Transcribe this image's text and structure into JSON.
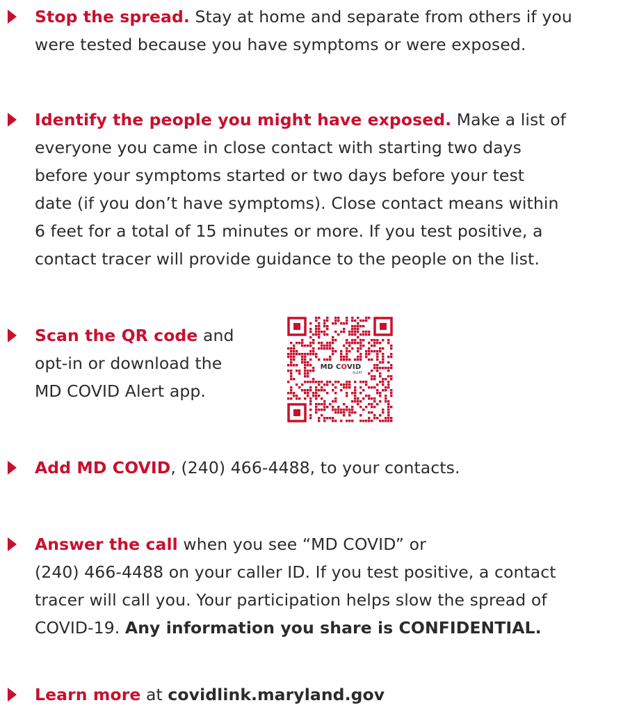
{
  "accent_color": "#c8102e",
  "text_color": "#2b2b2b",
  "items": [
    {
      "icon": "play-arrow-icon",
      "lines": [
        {
          "bold": "Stop the spread.",
          "rest": " Stay at home and separate from others if you"
        },
        {
          "rest": "were tested because you have symptoms or were exposed."
        }
      ]
    },
    {
      "icon": "play-arrow-icon",
      "lines": [
        {
          "bold": "Identify the people you might have exposed.",
          "rest": " Make a list of"
        },
        {
          "rest": "everyone you came in close contact with starting two days"
        },
        {
          "rest": "before your symptoms started or two days before your test"
        },
        {
          "rest": "date (if you don’t have symptoms). Close contact means within"
        },
        {
          "rest": "6 feet for a total of 15 minutes or more. If you test positive, a"
        },
        {
          "rest": "contact tracer will provide guidance to the people on the list."
        }
      ]
    },
    {
      "icon": "play-arrow-icon",
      "lines": [
        {
          "bold": "Scan the QR code",
          "rest": " and"
        },
        {
          "rest": "opt-in or download the"
        },
        {
          "rest": "MD COVID Alert app."
        }
      ]
    },
    {
      "icon": "play-arrow-icon",
      "lines": [
        {
          "bold": "Add MD COVID",
          "rest": ", (240) 466-4488, to your contacts."
        }
      ]
    },
    {
      "icon": "play-arrow-icon",
      "lines": [
        {
          "bold": "Answer the call",
          "rest": " when you see “MD COVID” or"
        },
        {
          "rest": "(240) 466-4488 on your caller ID. If you test positive, a contact"
        },
        {
          "rest": "tracer will call you. Your participation helps slow the spread of"
        },
        {
          "rest": "COVID-19. ",
          "strong": "Any information you share is CONFIDENTIAL."
        }
      ]
    },
    {
      "icon": "play-arrow-icon",
      "lines": [
        {
          "bold": "Learn more",
          "rest": " at ",
          "strong": "covidlink.maryland.gov"
        }
      ]
    }
  ],
  "qr": {
    "label_md": "MD C",
    "label_o": "O",
    "label_vid": "VID",
    "label_sub": "ALERT"
  }
}
